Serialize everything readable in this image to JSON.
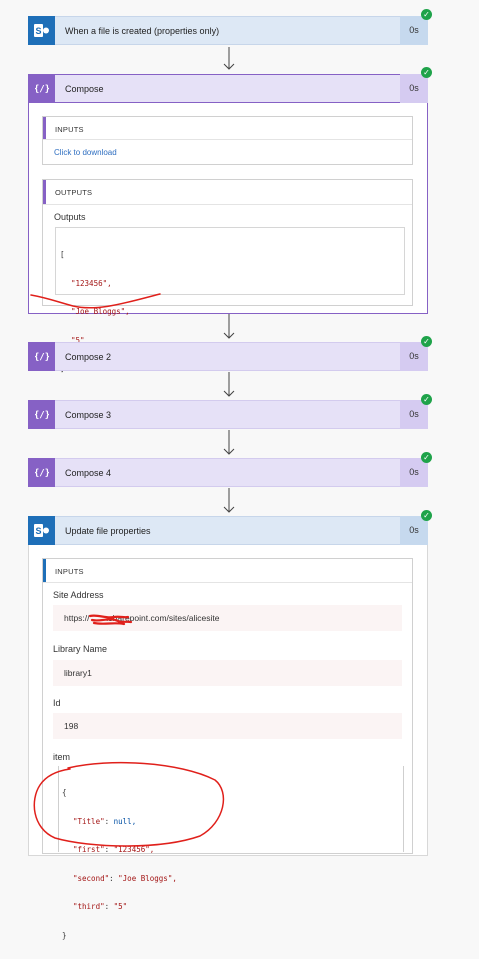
{
  "steps": {
    "trigger": {
      "title": "When a file is created (properties only)",
      "duration": "0s"
    },
    "compose1": {
      "title": "Compose",
      "duration": "0s",
      "inputs_label": "INPUTS",
      "download_link": "Click to download",
      "outputs_label": "OUTPUTS",
      "outputs_field_label": "Outputs",
      "outputs_code": [
        "[",
        "\"123456\",",
        "\"Joe Bloggs\",",
        "\"5\"",
        "]"
      ]
    },
    "compose2": {
      "title": "Compose 2",
      "duration": "0s"
    },
    "compose3": {
      "title": "Compose 3",
      "duration": "0s"
    },
    "compose4": {
      "title": "Compose 4",
      "duration": "0s"
    },
    "update": {
      "title": "Update file properties",
      "duration": "0s",
      "inputs_label": "INPUTS",
      "site_address_label": "Site Address",
      "site_address_value": "https://       .sharepoint.com/sites/alicesite",
      "library_label": "Library Name",
      "library_value": "library1",
      "id_label": "Id",
      "id_value": "198",
      "item_label": "item",
      "item_code": {
        "open": "{",
        "k1": "\"Title\"",
        "v1": "null,",
        "k2": "\"first\"",
        "v2": "\"123456\",",
        "k3": "\"second\"",
        "v3": "\"Joe Bloggs\",",
        "k4": "\"third\"",
        "v4": "\"5\"",
        "close": "}"
      }
    }
  },
  "colors": {
    "sharepoint": "#1e6fb8",
    "compose": "#8661c5",
    "success": "#1fa34a",
    "annotation": "#e0201b"
  },
  "icons": {
    "sharepoint": "sharepoint-icon",
    "compose": "compose-icon",
    "success": "check-icon",
    "arrow": "arrow-down-icon"
  }
}
